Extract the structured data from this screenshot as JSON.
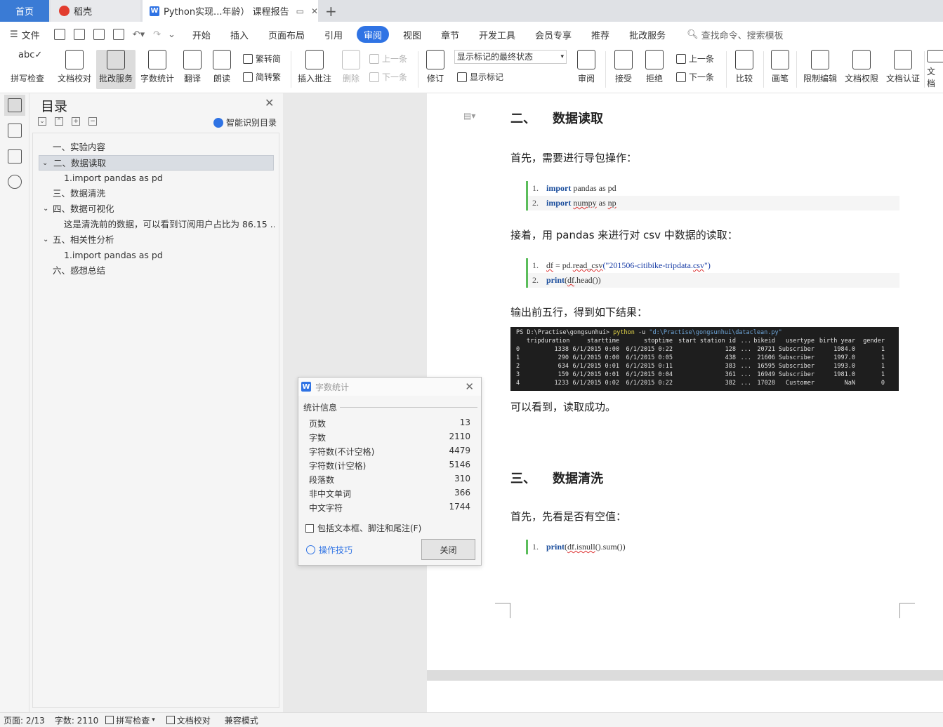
{
  "tabs": {
    "home": "首页",
    "daoke": "稻壳",
    "doc": "Python实现...年龄） 课程报告"
  },
  "menubar": {
    "file": "文件",
    "items": [
      "开始",
      "插入",
      "页面布局",
      "引用",
      "审阅",
      "视图",
      "章节",
      "开发工具",
      "会员专享",
      "推荐",
      "批改服务"
    ],
    "search": "查找命令、搜索模板"
  },
  "ribbon": {
    "spell": "拼写检查",
    "proofread": "文档校对",
    "correction": "批改服务",
    "wordcount": "字数统计",
    "translate": "翻译",
    "read": "朗读",
    "to_trad": "繁转简",
    "to_simp": "简转繁",
    "insert_comment": "插入批注",
    "delete": "删除",
    "prev1": "上一条",
    "next1": "下一条",
    "revise": "修订",
    "markup_state": "显示标记的最终状态",
    "show_markup": "显示标记",
    "review": "审阅",
    "accept": "接受",
    "reject": "拒绝",
    "prev2": "上一条",
    "next2": "下一条",
    "compare": "比较",
    "pen": "画笔",
    "restrict": "限制编辑",
    "rights": "文档权限",
    "certify": "文档认证",
    "more": "文档"
  },
  "nav": {
    "title": "目录",
    "smart": "智能识别目录",
    "items": [
      {
        "text": "一、实验内容"
      },
      {
        "text": "二、数据读取"
      },
      {
        "text": "1.import pandas as pd"
      },
      {
        "text": "三、数据清洗"
      },
      {
        "text": "四、数据可视化"
      },
      {
        "text": "这是清洗前的数据，可以看到订阅用户占比为 86.15 ..."
      },
      {
        "text": "五、相关性分析"
      },
      {
        "text": "1.import pandas as pd"
      },
      {
        "text": "六、感想总结"
      }
    ]
  },
  "doc": {
    "h_read_num": "二、",
    "h_read": "数据读取",
    "p1": "首先，需要进行导包操作：",
    "code1": [
      {
        "num": "1.",
        "kw": "import",
        "rest": " pandas as pd"
      },
      {
        "num": "2.",
        "kw": "import",
        "rest1": " ",
        "sq": "numpy",
        "rest2": " as ",
        "sq2": "np"
      }
    ],
    "p2": "接着，用 pandas 来进行对 csv 中数据的读取：",
    "code2_1_num": "1.",
    "code2_1_a": "df",
    "code2_1_b": " = pd.",
    "code2_1_c": "read_csv",
    "code2_1_d": "(\"201506-citibike-tripdata.",
    "code2_1_e": "csv",
    "code2_1_f": "\")",
    "code2_2_num": "2.",
    "code2_2_a": "print",
    "code2_2_b": "(",
    "code2_2_c": "df",
    "code2_2_d": ".head())",
    "p3": "输出前五行，得到如下结果：",
    "term": {
      "cmd_prefix": "PS D:\\Practise\\gongsunhui> ",
      "cmd_py": "python",
      "cmd_flag": " -u ",
      "cmd_path": "\"d:\\Practise\\gongsunhui\\dataclean.py\"",
      "headers": [
        "tripduration",
        "starttime",
        "stoptime",
        "start station id",
        "...",
        "bikeid",
        "usertype",
        "birth year",
        "gender"
      ],
      "rows": [
        [
          "0",
          "1338",
          "6/1/2015 0:00",
          "6/1/2015 0:22",
          "128",
          "...",
          "20721",
          "Subscriber",
          "1984.0",
          "1"
        ],
        [
          "1",
          "290",
          "6/1/2015 0:00",
          "6/1/2015 0:05",
          "438",
          "...",
          "21606",
          "Subscriber",
          "1997.0",
          "1"
        ],
        [
          "2",
          "634",
          "6/1/2015 0:01",
          "6/1/2015 0:11",
          "383",
          "...",
          "16595",
          "Subscriber",
          "1993.0",
          "1"
        ],
        [
          "3",
          "159",
          "6/1/2015 0:01",
          "6/1/2015 0:04",
          "361",
          "...",
          "16949",
          "Subscriber",
          "1981.0",
          "1"
        ],
        [
          "4",
          "1233",
          "6/1/2015 0:02",
          "6/1/2015 0:22",
          "382",
          "...",
          "17028",
          "Customer",
          "NaN",
          "0"
        ]
      ]
    },
    "p4": "可以看到，读取成功。",
    "h_clean_num": "三、",
    "h_clean": "数据清洗",
    "p5": "首先，先看是否有空值：",
    "code3_num": "1.",
    "code3_a": "print",
    "code3_b": "(",
    "code3_c": "df.isnull",
    "code3_d": "().sum())"
  },
  "dialog": {
    "title": "字数统计",
    "section": "统计信息",
    "stats": [
      {
        "label": "页数",
        "value": "13"
      },
      {
        "label": "字数",
        "value": "2110"
      },
      {
        "label": "字符数(不计空格)",
        "value": "4479"
      },
      {
        "label": "字符数(计空格)",
        "value": "5146"
      },
      {
        "label": "段落数",
        "value": "310"
      },
      {
        "label": "非中文单词",
        "value": "366"
      },
      {
        "label": "中文字符",
        "value": "1744"
      }
    ],
    "checkbox": "包括文本框、脚注和尾注(F)",
    "tips": "操作技巧",
    "close": "关闭"
  },
  "status": {
    "page": "页面: 2/13",
    "words": "字数: 2110",
    "spell": "拼写检查",
    "proofread": "文档校对",
    "compat": "兼容模式"
  },
  "colors": {
    "accent": "#2f73e4",
    "code_bar": "#5bbd5b",
    "terminal_bg": "#1e1e1e"
  }
}
